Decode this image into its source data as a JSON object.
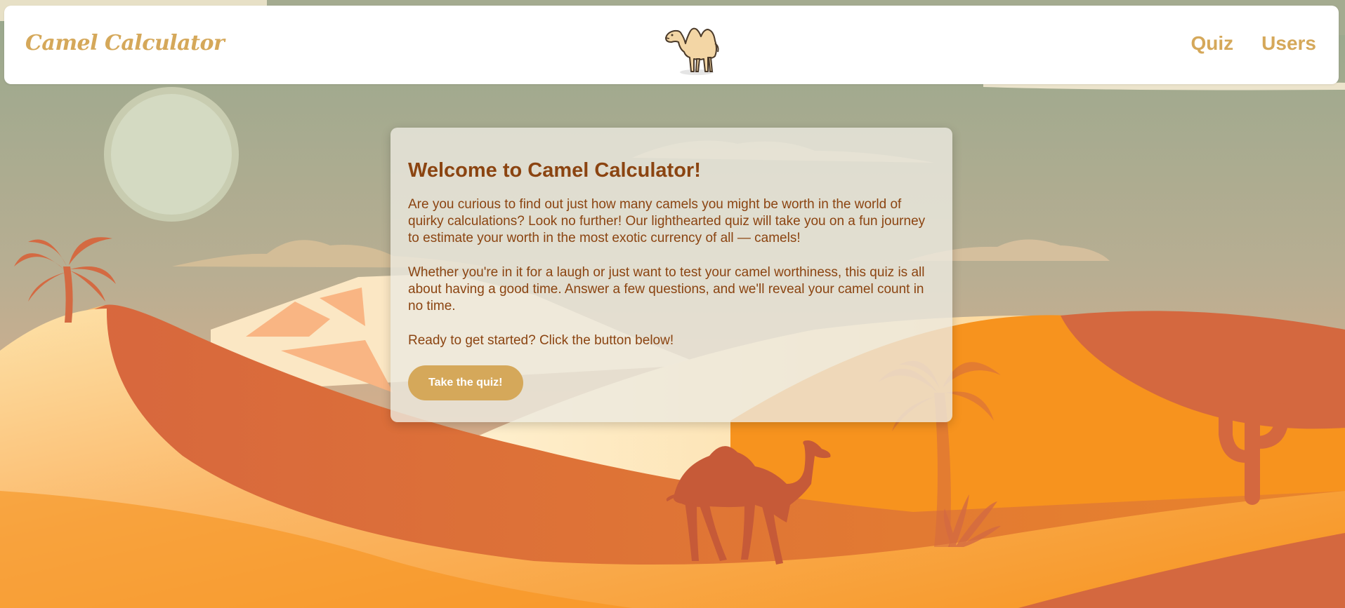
{
  "navbar": {
    "brand": "Camel Calculator",
    "links": [
      {
        "label": "Quiz"
      },
      {
        "label": "Users"
      }
    ]
  },
  "main": {
    "title": "Welcome to Camel Calculator!",
    "paragraphs": [
      "Are you curious to find out just how many camels you might be worth in the world of quirky calculations? Look no further! Our lighthearted quiz will take you on a fun journey to estimate your worth in the most exotic currency of all — camels!",
      "Whether you're in it for a laugh or just want to test your camel worthiness, this quiz is all about having a good time. Answer a few questions, and we'll reveal your camel count in no time.",
      "Ready to get started? Click the button below!"
    ],
    "cta_label": "Take the quiz!"
  },
  "colors": {
    "accent": "#d5a85a",
    "heading_text": "#8b4411",
    "sky": "#a9ab90",
    "dune_orange": "#f7931e",
    "dune_terracotta": "#d46a42"
  },
  "icons": {
    "logo": "camel-icon"
  }
}
